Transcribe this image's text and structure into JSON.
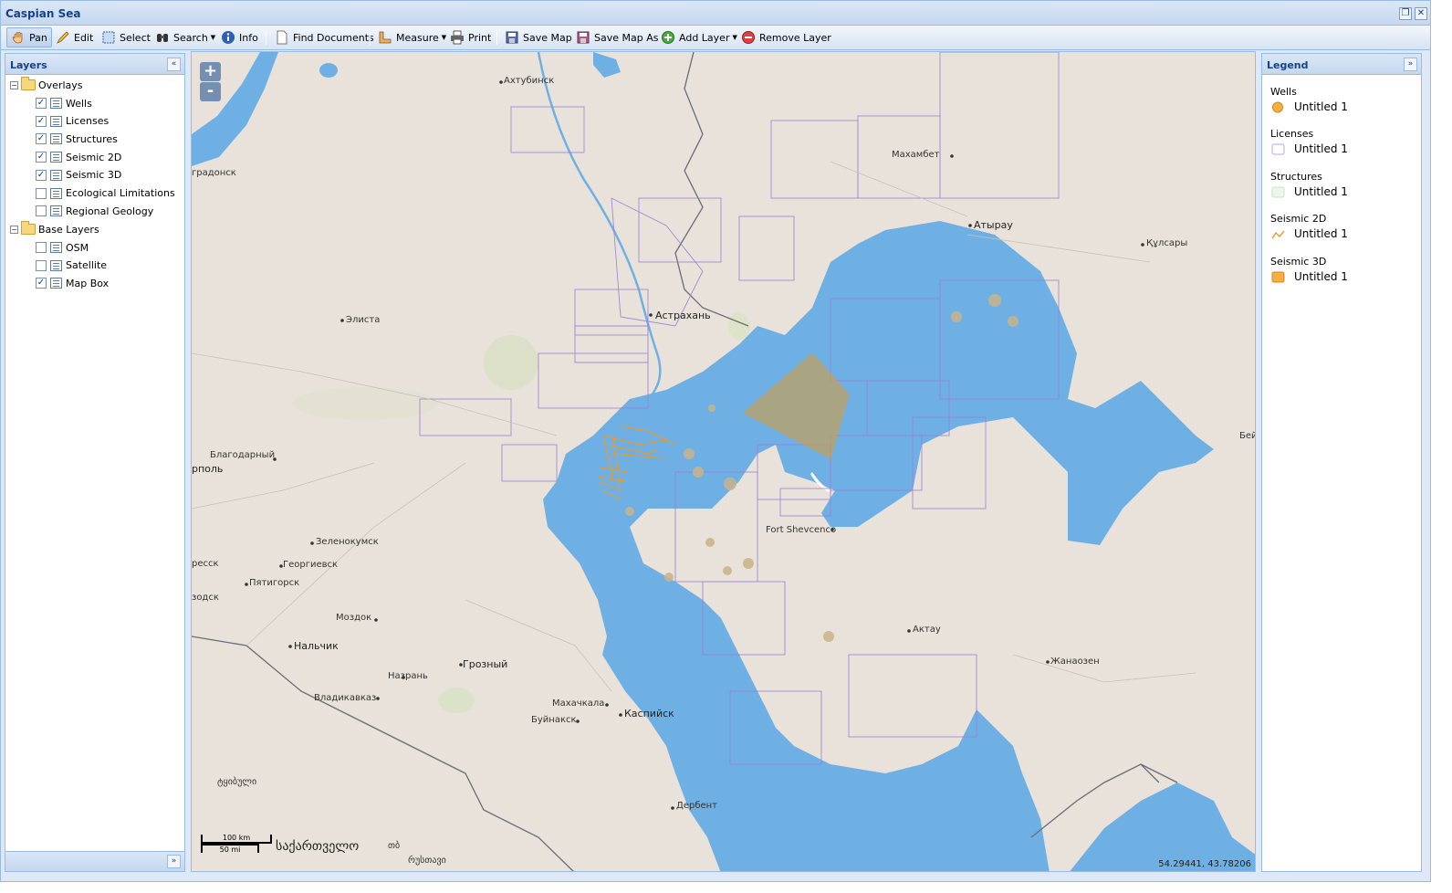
{
  "window": {
    "title": "Caspian Sea"
  },
  "toolbar": {
    "pan": "Pan",
    "edit": "Edit",
    "select": "Select",
    "search": "Search",
    "info": "Info",
    "find_documents": "Find Documents",
    "measure": "Measure",
    "print": "Print",
    "save_map": "Save Map",
    "save_map_as": "Save Map As",
    "add_layer": "Add Layer",
    "remove_layer": "Remove Layer"
  },
  "layers": {
    "title": "Layers",
    "overlays": {
      "label": "Overlays",
      "items": [
        {
          "label": "Wells",
          "checked": true
        },
        {
          "label": "Licenses",
          "checked": true
        },
        {
          "label": "Structures",
          "checked": true
        },
        {
          "label": "Seismic 2D",
          "checked": true
        },
        {
          "label": "Seismic 3D",
          "checked": true
        },
        {
          "label": "Ecological Limitations",
          "checked": false
        },
        {
          "label": "Regional Geology",
          "checked": false
        }
      ]
    },
    "base": {
      "label": "Base Layers",
      "items": [
        {
          "label": "OSM",
          "checked": false
        },
        {
          "label": "Satellite",
          "checked": false
        },
        {
          "label": "Map Box",
          "checked": true
        }
      ]
    }
  },
  "legend": {
    "title": "Legend",
    "groups": [
      {
        "name": "Wells",
        "entry": "Untitled 1",
        "swatch": "circle",
        "color": "#f5b041"
      },
      {
        "name": "Licenses",
        "entry": "Untitled 1",
        "swatch": "box",
        "color": "#b9a6e0"
      },
      {
        "name": "Structures",
        "entry": "Untitled 1",
        "swatch": "box",
        "color": "#c8e6c0"
      },
      {
        "name": "Seismic 2D",
        "entry": "Untitled 1",
        "swatch": "line",
        "color": "#e69a2e"
      },
      {
        "name": "Seismic 3D",
        "entry": "Untitled 1",
        "swatch": "box-filled",
        "color": "#f5b041"
      }
    ]
  },
  "map": {
    "zoom_in": "+",
    "zoom_out": "-",
    "coordinates": "54.29441, 43.78206",
    "scale_km": "100 km",
    "scale_mi": "50 mi",
    "colors": {
      "water": "#6fb0e4",
      "land": "#e8e0d8",
      "license": "#9b7fd4",
      "seismic": "#e69a2e"
    },
    "labels": {
      "akhtubinsk": "Ахтубинск",
      "makhambet": "Махамбет",
      "atyrau": "Атырау",
      "kulsary": "Құлсары",
      "gradonsk": "градонск",
      "elista": "Элиста",
      "astrakhan": "Астрахань",
      "blagodarny": "Благодарный",
      "opol": "рполь",
      "bei": "Бей",
      "fort": "Fort Shevcenco",
      "zelenokumsk": "Зеленокумск",
      "essk": "ресск",
      "georgievsk": "Георгиевск",
      "pyatigorsk": "Пятигорск",
      "vodsk": "зодск",
      "mozdok": "Моздок",
      "aktau": "Актау",
      "nalchik": "Нальчик",
      "grozny": "Грозный",
      "zhanaozen": "Жанаозен",
      "nazran": "Назрань",
      "vladikavkaz": "Владикавказ",
      "makhachkala": "Махачкала",
      "kaspiysk": "Каспийск",
      "buynaksk": "Буйнакск",
      "derbent": "Дербент",
      "georgia": "საქართველო",
      "tkibuli": "ტყიბული",
      "rustavi": "რუსთავი",
      "georgia_small": "თბ"
    }
  }
}
